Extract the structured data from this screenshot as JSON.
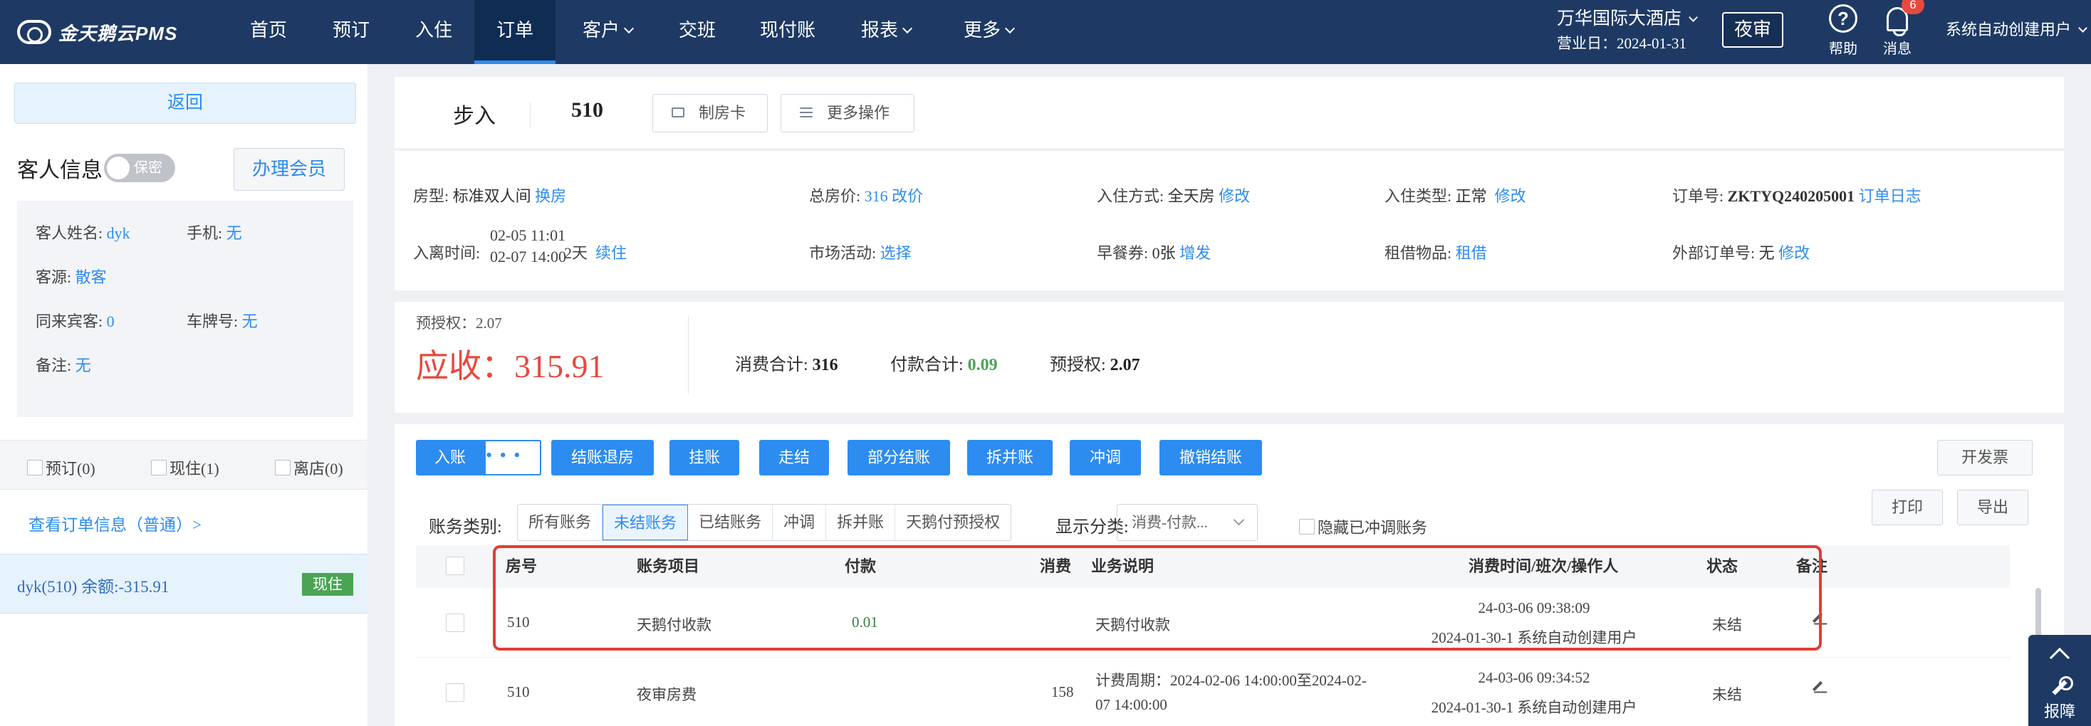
{
  "topbar": {
    "logo": "金天鹅云PMS",
    "nav": [
      {
        "label": "首页",
        "dropdown": false
      },
      {
        "label": "预订",
        "dropdown": false
      },
      {
        "label": "入住",
        "dropdown": false
      },
      {
        "label": "订单",
        "dropdown": false
      },
      {
        "label": "客户",
        "dropdown": true
      },
      {
        "label": "交班",
        "dropdown": false
      },
      {
        "label": "现付账",
        "dropdown": false
      },
      {
        "label": "报表",
        "dropdown": true
      },
      {
        "label": "更多",
        "dropdown": true
      }
    ],
    "active_nav": "订单",
    "hotel_name": "万华国际大酒店",
    "business_day": "营业日：2024-01-31",
    "night_audit": "夜审",
    "help": "帮助",
    "messages": "消息",
    "message_count": "6",
    "user": "系统自动创建用户"
  },
  "left": {
    "back": "返回",
    "guest_info": "客人信息",
    "secret": "保密",
    "member_btn": "办理会员",
    "fields": {
      "name_label": "客人姓名:",
      "name": "dyk",
      "phone_label": "手机:",
      "phone": "无",
      "source_label": "客源:",
      "source": "散客",
      "companions_label": "同来宾客:",
      "companions": "0",
      "plate_label": "车牌号:",
      "plate": "无",
      "remark_label": "备注:",
      "remark": "无"
    },
    "status_filters": [
      "预订(0)",
      "现住(1)",
      "离店(0)"
    ],
    "view_order": "查看订单信息（普通）>",
    "room_entry": "dyk(510)   余额:-315.91",
    "room_status": "现住"
  },
  "header": {
    "type": "步入",
    "room": "510",
    "make_card": "制房卡",
    "more_ops": "更多操作"
  },
  "details": {
    "room_type_label": "房型:",
    "room_type": "标准双人间",
    "change_room": "换房",
    "total_price_label": "总房价:",
    "total_price": "316",
    "change_price": "改价",
    "checkin_mode_label": "入住方式:",
    "checkin_mode": "全天房",
    "edit1": "修改",
    "checkin_type_label": "入住类型:",
    "checkin_type": "正常",
    "edit2": "修改",
    "order_no_label": "订单号:",
    "order_no": "ZKTYQ240205001",
    "order_log": "订单日志",
    "stay_label": "入离时间:",
    "arrive": "02-05 11:01",
    "depart": "02-07 14:00",
    "nights": "2天",
    "extend": "续住",
    "market_label": "市场活动:",
    "market": "选择",
    "breakfast_label": "早餐券:",
    "breakfast": "0张",
    "breakfast_add": "增发",
    "rental_label": "租借物品:",
    "rental": "租借",
    "external_label": "外部订单号:",
    "external": "无",
    "edit3": "修改"
  },
  "summary": {
    "pre_auth_top": "预授权：2.07",
    "receivable": "应收：315.91",
    "consume_label": "消费合计:",
    "consume": "316",
    "pay_label": "付款合计:",
    "pay": "0.09",
    "preauth_label": "预授权:",
    "preauth": "2.07"
  },
  "ledger": {
    "actions": [
      "入账",
      "结账退房",
      "挂账",
      "走结",
      "部分结账",
      "拆并账",
      "冲调",
      "撤销结账"
    ],
    "more": "• • •",
    "invoice": "开发票",
    "print": "打印",
    "export": "导出",
    "category_label": "账务类别:",
    "categories": [
      "所有账务",
      "未结账务",
      "已结账务",
      "冲调",
      "拆并账",
      "天鹅付预授权"
    ],
    "active_category": "未结账务",
    "display_label": "显示分类:",
    "display_value": "消费-付款...",
    "hide_reversed": "隐藏已冲调账务",
    "columns": [
      "房号",
      "账务项目",
      "付款",
      "消费",
      "业务说明",
      "消费时间/班次/操作人",
      "状态",
      "备注"
    ],
    "rows": [
      {
        "room": "510",
        "item": "天鹅付收款",
        "pay": "0.01",
        "consume": "",
        "desc1": "天鹅付收款",
        "desc2": "",
        "time": "24-03-06 09:38:09",
        "shift": "2024-01-30-1 系统自动创建用户",
        "status": "未结"
      },
      {
        "room": "510",
        "item": "夜审房费",
        "pay": "",
        "consume": "158",
        "desc1": "计费周期：2024-02-06 14:00:00至2024-02-",
        "desc2": "07 14:00:00",
        "time": "24-03-06 09:34:52",
        "shift": "2024-01-30-1 系统自动创建用户",
        "status": "未结"
      }
    ]
  },
  "report_btn": "报障",
  "colors": {
    "nav": "#1e3a64",
    "accent": "#2d8cf0",
    "due": "#e8493e",
    "ok": "#4aa454",
    "highlight": "#e23c34"
  }
}
